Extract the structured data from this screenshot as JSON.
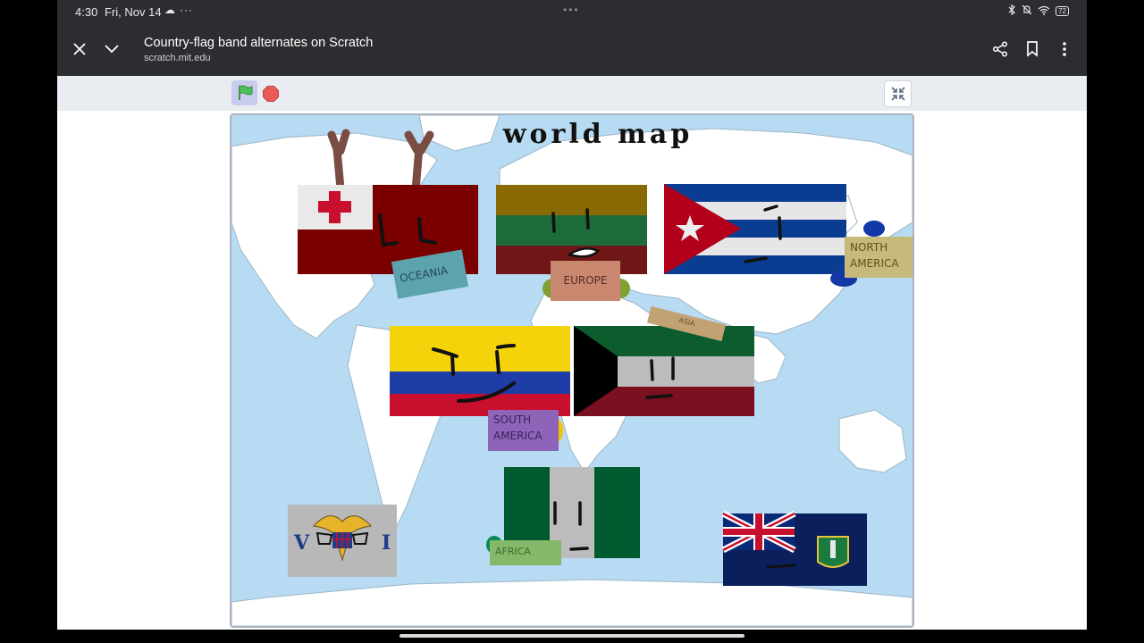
{
  "status_bar": {
    "time": "4:30",
    "date": "Fri, Nov 14",
    "cloud_icon": "cloud-icon",
    "more": "···",
    "center_dots": "•••",
    "battery": "72"
  },
  "toolbar": {
    "title": "Country-flag band alternates on Scratch",
    "url": "scratch.mit.edu",
    "icons": [
      "close-icon",
      "chevron-down-icon",
      "share-icon",
      "bookmark-icon",
      "more-vert-icon"
    ]
  },
  "scratch_controls": {
    "green_flag": "green-flag-icon",
    "stop": "stop-icon",
    "fullscreen": "exit-fullscreen-icon"
  },
  "stage": {
    "title": "world map",
    "tags": {
      "oceania": "OCEANIA",
      "europe": "EUROPE",
      "north_america_1": "NORTH",
      "north_america_2": "AMERICA",
      "south_america_1": "SOUTH",
      "south_america_2": "AMERICA",
      "asia": "ASIA",
      "africa": "AFRICA"
    },
    "colors": {
      "ocean": "#b6dbf2",
      "land": "#ffffff",
      "green_flag": "#4cbf56",
      "stop": "#ec5959"
    }
  }
}
